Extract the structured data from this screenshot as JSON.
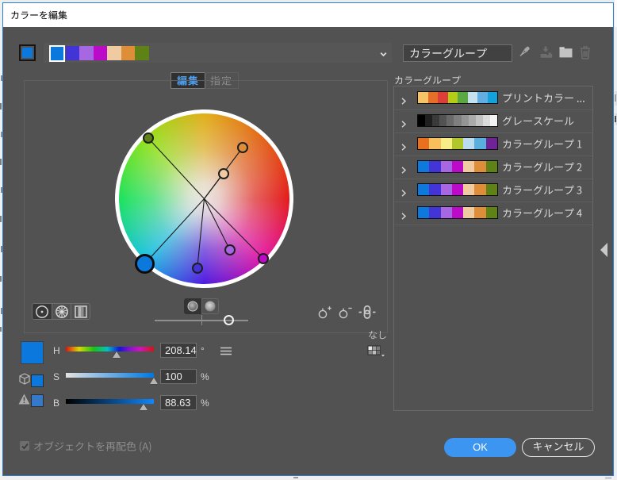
{
  "window": {
    "title": "カラーを編集",
    "accent_border_color": "#2b7cd3"
  },
  "active_colors_bar": {
    "proxy_color": "#0b78de",
    "swatches": [
      "#0b78de",
      "#4334d8",
      "#a767e2",
      "#bb0bc9",
      "#f0cba2",
      "#de8e38",
      "#5f8217"
    ],
    "selected_index": 0
  },
  "group_name_input": {
    "value": "カラーグループ"
  },
  "toolbar_icons": [
    {
      "name": "eyedropper",
      "enabled": true
    },
    {
      "name": "save-group",
      "enabled": false
    },
    {
      "name": "new-group-folder",
      "enabled": true
    },
    {
      "name": "delete-group",
      "enabled": false
    }
  ],
  "tabs": [
    {
      "label": "編集",
      "active": true
    },
    {
      "label": "指定",
      "active": false
    }
  ],
  "wheel": {
    "selected_marker_color": "#0b78de",
    "marker_colors": [
      "#5f8217",
      "#de8e38",
      "#f0cba2",
      "#4334d8",
      "#a767e2",
      "#bb0bc9"
    ],
    "brightness_percent": 88.63
  },
  "view_buttons": [
    {
      "name": "smooth-color-wheel",
      "active": true
    },
    {
      "name": "segmented-color-wheel",
      "active": false
    },
    {
      "name": "color-bars",
      "active": false
    }
  ],
  "wheel_display_toggles": [
    {
      "name": "show-saturation-and-hue",
      "active": true
    },
    {
      "name": "show-brightness-and-hue",
      "active": false
    }
  ],
  "harmony_tools": [
    {
      "name": "add-color-tool"
    },
    {
      "name": "remove-color-tool"
    },
    {
      "name": "unlink-harmony-colors"
    }
  ],
  "color_limit": {
    "value": "なし",
    "button": "limit-color-group-to-swatch-library"
  },
  "hsb": {
    "h": {
      "label": "H",
      "value": "208.14",
      "unit": "°"
    },
    "s": {
      "label": "S",
      "value": "100",
      "unit": "%"
    },
    "b": {
      "label": "B",
      "value": "88.63",
      "unit": "%"
    }
  },
  "color_groups": {
    "label": "カラーグループ",
    "groups": [
      {
        "name": "プリントカラー ...",
        "colors": [
          "#f6c366",
          "#e56f26",
          "#dd3e3a",
          "#b4cc16",
          "#59a841",
          "#c5e1f0",
          "#62aee0",
          "#12a3dd"
        ]
      },
      {
        "name": "グレースケール",
        "colors": [
          "#000000",
          "#1f1f1f",
          "#3a3a3a",
          "#525252",
          "#696969",
          "#7f7f7f",
          "#949494",
          "#aaaaaa",
          "#c2c2c2",
          "#dbdbdb",
          "#f3f3f3"
        ]
      },
      {
        "name": "カラーグループ 1",
        "colors": [
          "#e8701f",
          "#f7c05c",
          "#f8ed86",
          "#b0c62b",
          "#bbdbef",
          "#5bafdd",
          "#6f2394"
        ]
      },
      {
        "name": "カラーグループ 2",
        "colors": [
          "#0e79dc",
          "#4334d8",
          "#a767e2",
          "#bb0bc9",
          "#f0cba2",
          "#de8e38",
          "#5f8217"
        ]
      },
      {
        "name": "カラーグループ 3",
        "colors": [
          "#0e79dc",
          "#4334d8",
          "#a767e2",
          "#bb0bc9",
          "#f0cba2",
          "#de8e38",
          "#5f8217"
        ]
      },
      {
        "name": "カラーグループ 4",
        "colors": [
          "#0e79dc",
          "#4334d8",
          "#a767e2",
          "#bb0bc9",
          "#f0cba2",
          "#de8e38",
          "#5f8217"
        ]
      }
    ]
  },
  "footer": {
    "recolor_label": "オブジェクトを再配色 (A)",
    "recolor_checked": true,
    "recolor_enabled": false,
    "ok_label": "OK",
    "cancel_label": "キャンセル"
  }
}
